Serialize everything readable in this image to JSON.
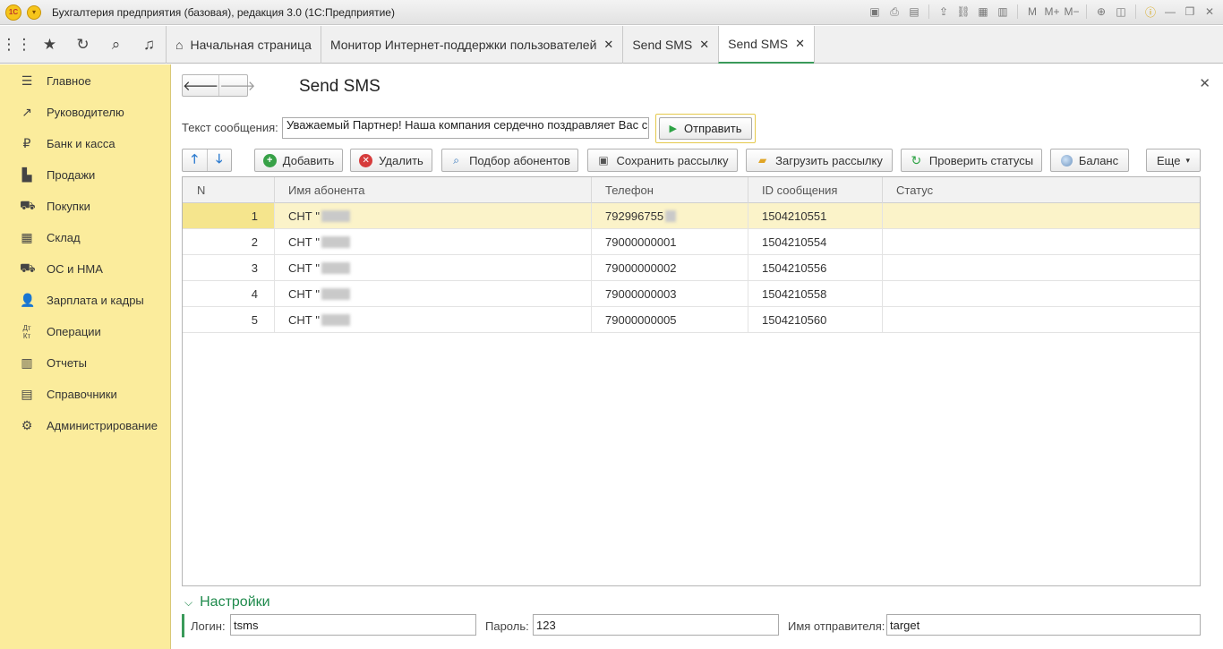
{
  "window": {
    "logo": "1С",
    "title": "Бухгалтерия предприятия (базовая), редакция 3.0  (1С:Предприятие)"
  },
  "tabs": [
    {
      "label": "Начальная страница",
      "closable": false
    },
    {
      "label": "Монитор Интернет-поддержки пользователей",
      "closable": true
    },
    {
      "label": "Send SMS",
      "closable": true
    },
    {
      "label": "Send SMS",
      "closable": true,
      "active": true
    }
  ],
  "sidebar": {
    "items": [
      {
        "label": "Главное",
        "icon": "menu-icon"
      },
      {
        "label": "Руководителю",
        "icon": "trend-icon"
      },
      {
        "label": "Банк и касса",
        "icon": "ruble-icon"
      },
      {
        "label": "Продажи",
        "icon": "bag-icon"
      },
      {
        "label": "Покупки",
        "icon": "cart-icon"
      },
      {
        "label": "Склад",
        "icon": "warehouse-icon"
      },
      {
        "label": "ОС и НМА",
        "icon": "truck-icon"
      },
      {
        "label": "Зарплата и кадры",
        "icon": "people-icon"
      },
      {
        "label": "Операции",
        "icon": "dt-kt-icon"
      },
      {
        "label": "Отчеты",
        "icon": "bar-chart-icon"
      },
      {
        "label": "Справочники",
        "icon": "books-icon"
      },
      {
        "label": "Администрирование",
        "icon": "gear-icon"
      }
    ]
  },
  "form": {
    "title": "Send SMS",
    "message_label": "Текст сообщения:",
    "message_value": "Уважаемый Партнер! Наша компания сердечно поздравляет Вас с",
    "send_label": "Отправить"
  },
  "toolbar": {
    "add": "Добавить",
    "delete": "Удалить",
    "pick": "Подбор абонентов",
    "save": "Сохранить рассылку",
    "load": "Загрузить рассылку",
    "check": "Проверить статусы",
    "balance": "Баланс",
    "more": "Еще"
  },
  "table": {
    "columns": [
      "N",
      "Имя абонента",
      "Телефон",
      "ID сообщения",
      "Статус"
    ],
    "rows": [
      {
        "n": "1",
        "name": "СНТ \"",
        "phone": "792996755",
        "id": "1504210551",
        "status": ""
      },
      {
        "n": "2",
        "name": "СНТ \"",
        "phone": "79000000001",
        "id": "1504210554",
        "status": ""
      },
      {
        "n": "3",
        "name": "СНТ \"",
        "phone": "79000000002",
        "id": "1504210556",
        "status": ""
      },
      {
        "n": "4",
        "name": "СНТ \"",
        "phone": "79000000003",
        "id": "1504210558",
        "status": ""
      },
      {
        "n": "5",
        "name": "СНТ \"",
        "phone": "79000000005",
        "id": "1504210560",
        "status": ""
      }
    ]
  },
  "settings": {
    "title": "Настройки",
    "login_label": "Логин:",
    "login_value": "tsms",
    "password_label": "Пароль:",
    "password_value": "123",
    "sender_label": "Имя отправителя:",
    "sender_value": "target"
  }
}
